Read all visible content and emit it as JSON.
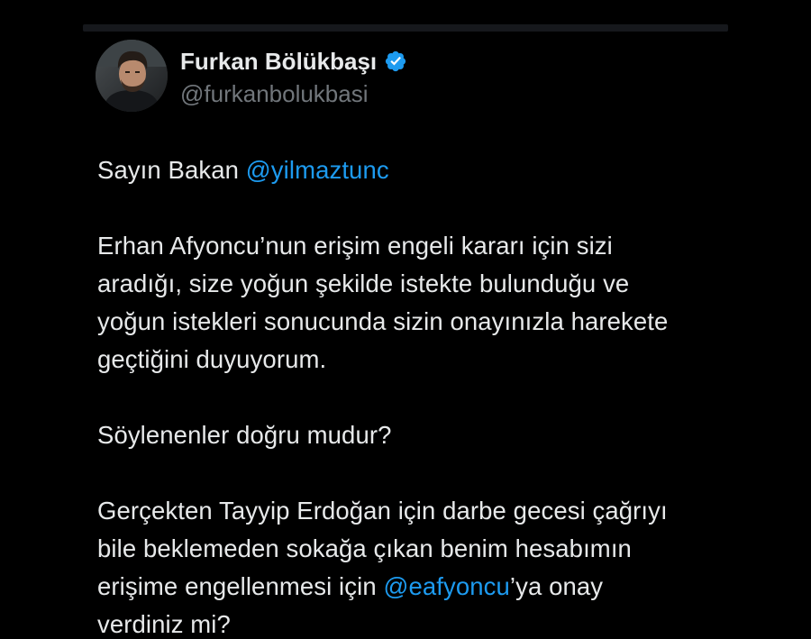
{
  "author": {
    "name": "Furkan Bölükbaşı",
    "handle": "@furkanbolukbasi",
    "verified_icon": "verified-badge-icon",
    "verified_color": "#1d9bf0"
  },
  "tweet": {
    "greeting_prefix": "Sayın Bakan ",
    "greeting_mention": "@yilmaztunc",
    "p2_lines": [
      "Erhan Afyoncu’nun erişim engeli kararı için sizi",
      "aradığı, size yoğun şekilde istekte bulunduğu ve",
      "yoğun istekleri sonucunda sizin onayınızla harekete",
      "geçtiğini duyuyorum."
    ],
    "p3": "Söylenenler doğru mudur?",
    "p4_lines": [
      "Gerçekten Tayyip Erdoğan için darbe gecesi çağrıyı",
      "bile beklemeden sokağa çıkan benim hesabımın"
    ],
    "p4_line3_prefix": "erişime engellenmesi için ",
    "p4_line3_mention": "@eafyoncu",
    "p4_line3_suffix": "’ya onay",
    "p4_line4": "verdiniz mi?"
  },
  "colors": {
    "background": "#000000",
    "text": "#e7e9ea",
    "secondary_text": "#71767b",
    "mention": "#1d9bf0"
  }
}
